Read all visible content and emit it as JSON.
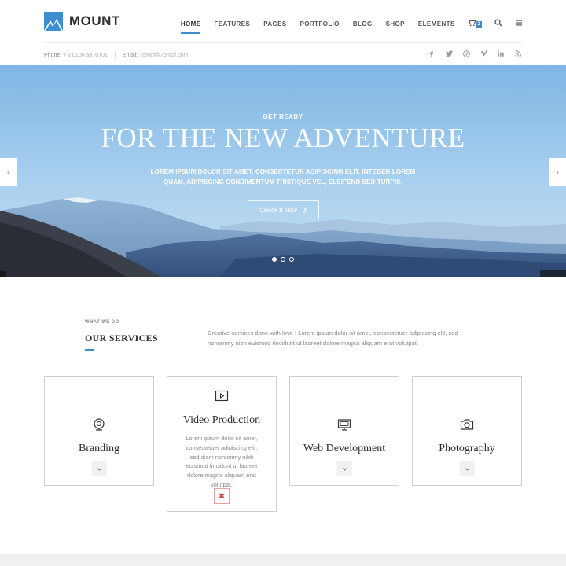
{
  "brand": {
    "name": "MOUNT",
    "accent": "#3b8fd1"
  },
  "nav": {
    "items": [
      {
        "label": "HOME",
        "active": true
      },
      {
        "label": "FEATURES"
      },
      {
        "label": "PAGES"
      },
      {
        "label": "PORTFOLIO"
      },
      {
        "label": "BLOG"
      },
      {
        "label": "SHOP"
      },
      {
        "label": "ELEMENTS"
      }
    ],
    "cart_count": "2",
    "icons": [
      "cart-icon",
      "search-icon",
      "menu-icon"
    ]
  },
  "infobar": {
    "phone_label": "Phone:",
    "phone": "+ 2 0106 5370701",
    "email_label": "Email:",
    "email": "7oroof@7oroof.com",
    "social": [
      "facebook-icon",
      "twitter-icon",
      "pinterest-icon",
      "vimeo-icon",
      "linkedin-icon",
      "rss-icon"
    ]
  },
  "hero": {
    "kicker": "GET READY",
    "title": "FOR THE NEW ADVENTURE",
    "subtitle": "LOREM IPSUM DOLOR SIT AMET, CONSECTETUR ADIPISCING ELIT. INTEGER LOREM QUAM, ADIPISCING CONDIMENTUM TRISTIQUE VEL, ELEIFEND SED TURPIS.",
    "button_label": "Check It Now",
    "slides": 3,
    "active_slide": 1
  },
  "services": {
    "kicker": "WHAT WE DO",
    "title": "OUR SERVICES",
    "description": "Creative services done with love ! Lorem ipsum dolor sit amet, consectetuer adipiscing elit, sed nonummy nibh euismod tincidunt ut laoreet dolore magna aliquam erat volutpat.",
    "cards": [
      {
        "title": "Branding",
        "icon": "branding-icon",
        "expanded": false
      },
      {
        "title": "Video Production",
        "icon": "video-icon",
        "expanded": true,
        "text": "Lorem ipsum dolor sit amet, consectetuer adipiscing elit, sed diam nonummy nibh euismod tincidunt ut laoreet dolore magna aliquam erat volutpat."
      },
      {
        "title": "Web Development",
        "icon": "monitor-icon",
        "expanded": false
      },
      {
        "title": "Photography",
        "icon": "camera-icon",
        "expanded": false
      }
    ]
  }
}
